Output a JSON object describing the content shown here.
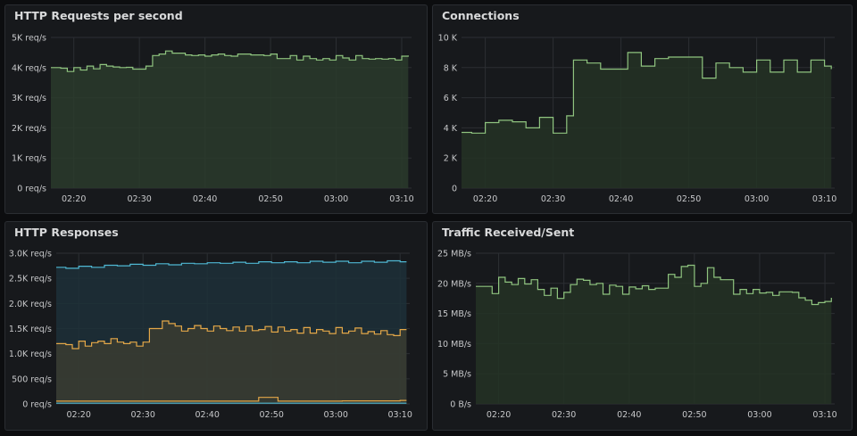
{
  "chart_data": [
    {
      "id": "rps",
      "type": "line",
      "title": "HTTP Requests per second",
      "ylim": [
        0,
        5000
      ],
      "yticks": [
        0,
        1000,
        2000,
        3000,
        4000,
        5000
      ],
      "ytick_labels": [
        "0 req/s",
        "1K req/s",
        "2K req/s",
        "3K req/s",
        "4K req/s",
        "5K req/s"
      ],
      "xlim": [
        16.5,
        71.5
      ],
      "xticks": [
        20,
        30,
        40,
        50,
        60,
        70
      ],
      "xtick_labels": [
        "02:20",
        "02:30",
        "02:40",
        "02:50",
        "03:00",
        "03:10"
      ],
      "series": [
        {
          "color": "#8fc47f",
          "fill": "#2a3b2b",
          "x": [
            16.5,
            18,
            19,
            20,
            21,
            22,
            23,
            24,
            25,
            26,
            27,
            28,
            29,
            30,
            31,
            32,
            33,
            34,
            35,
            36,
            37,
            38,
            39,
            40,
            41,
            42,
            43,
            44,
            45,
            46,
            47,
            48,
            49,
            50,
            51,
            52,
            53,
            54,
            55,
            56,
            57,
            58,
            59,
            60,
            61,
            62,
            63,
            64,
            65,
            66,
            67,
            68,
            69,
            70,
            71
          ],
          "y": [
            4000,
            3980,
            3870,
            4000,
            3920,
            4050,
            3960,
            4100,
            4050,
            4020,
            4000,
            4010,
            3950,
            3950,
            4050,
            4400,
            4450,
            4550,
            4480,
            4480,
            4420,
            4400,
            4420,
            4380,
            4420,
            4450,
            4400,
            4380,
            4450,
            4450,
            4420,
            4420,
            4400,
            4450,
            4300,
            4300,
            4400,
            4250,
            4380,
            4300,
            4250,
            4300,
            4250,
            4400,
            4320,
            4250,
            4400,
            4300,
            4280,
            4300,
            4280,
            4300,
            4250,
            4380,
            4400
          ]
        }
      ]
    },
    {
      "id": "conn",
      "type": "line",
      "title": "Connections",
      "ylim": [
        0,
        10000
      ],
      "yticks": [
        0,
        2000,
        4000,
        6000,
        8000,
        10000
      ],
      "ytick_labels": [
        "0",
        "2 K",
        "4 K",
        "6 K",
        "8 K",
        "10 K"
      ],
      "xlim": [
        16.5,
        71.5
      ],
      "xticks": [
        20,
        30,
        40,
        50,
        60,
        70
      ],
      "xtick_labels": [
        "02:20",
        "02:30",
        "02:40",
        "02:50",
        "03:00",
        "03:10"
      ],
      "series": [
        {
          "color": "#8fc47f",
          "fill": "#243325",
          "x": [
            16.5,
            18,
            20,
            22,
            24,
            26,
            28,
            30,
            32,
            33,
            35,
            37,
            39,
            41,
            43,
            45,
            47,
            50,
            52,
            54,
            56,
            58,
            60,
            62,
            64,
            66,
            68,
            70,
            71
          ],
          "y": [
            3700,
            3650,
            4350,
            4500,
            4400,
            4000,
            4700,
            3650,
            4800,
            8500,
            8300,
            7900,
            7900,
            9000,
            8100,
            8600,
            8700,
            8700,
            7300,
            8300,
            8000,
            7700,
            8500,
            7700,
            8500,
            7700,
            8500,
            8100,
            7900
          ]
        }
      ]
    },
    {
      "id": "resp",
      "type": "area",
      "title": "HTTP Responses",
      "ylim": [
        0,
        3000
      ],
      "yticks": [
        0,
        500,
        1000,
        1500,
        2000,
        2500,
        3000
      ],
      "ytick_labels": [
        "0 req/s",
        "500 req/s",
        "1.0K req/s",
        "1.5K req/s",
        "2.0K req/s",
        "2.5K req/s",
        "3.0K req/s"
      ],
      "xlim": [
        16.5,
        71.5
      ],
      "xticks": [
        20,
        30,
        40,
        50,
        60,
        70
      ],
      "xtick_labels": [
        "02:20",
        "02:30",
        "02:40",
        "02:50",
        "03:00",
        "03:10"
      ],
      "series": [
        {
          "color": "#4fb7d2",
          "fill": "#1d3038",
          "x": [
            16.5,
            18,
            20,
            22,
            24,
            26,
            28,
            30,
            32,
            34,
            36,
            38,
            40,
            42,
            44,
            46,
            48,
            50,
            52,
            54,
            56,
            58,
            60,
            62,
            64,
            66,
            68,
            70,
            71
          ],
          "y": [
            2720,
            2700,
            2740,
            2720,
            2760,
            2750,
            2780,
            2760,
            2790,
            2770,
            2800,
            2790,
            2810,
            2800,
            2820,
            2800,
            2830,
            2810,
            2830,
            2810,
            2840,
            2820,
            2840,
            2810,
            2840,
            2820,
            2850,
            2830,
            2830
          ]
        },
        {
          "color": "#e3a748",
          "fill": "#3a3c31",
          "x": [
            16.5,
            18,
            19,
            20,
            21,
            22,
            23,
            24,
            25,
            26,
            27,
            28,
            29,
            30,
            31,
            32,
            33,
            34,
            35,
            36,
            37,
            38,
            39,
            40,
            41,
            42,
            43,
            44,
            45,
            46,
            47,
            48,
            49,
            50,
            51,
            52,
            53,
            54,
            55,
            56,
            57,
            58,
            59,
            60,
            61,
            62,
            63,
            64,
            65,
            66,
            67,
            68,
            69,
            70,
            71
          ],
          "y": [
            1200,
            1180,
            1100,
            1250,
            1150,
            1220,
            1250,
            1200,
            1300,
            1230,
            1200,
            1230,
            1150,
            1230,
            1500,
            1500,
            1650,
            1600,
            1550,
            1450,
            1500,
            1560,
            1500,
            1450,
            1550,
            1500,
            1460,
            1530,
            1450,
            1550,
            1460,
            1480,
            1540,
            1430,
            1530,
            1450,
            1480,
            1410,
            1520,
            1410,
            1480,
            1450,
            1400,
            1520,
            1410,
            1450,
            1510,
            1400,
            1440,
            1390,
            1460,
            1380,
            1360,
            1480,
            1480
          ]
        },
        {
          "color": "#e3a748",
          "fill": "",
          "x": [
            16.5,
            25,
            26,
            47,
            48,
            50,
            51,
            60,
            61,
            70,
            71
          ],
          "y": [
            55,
            55,
            55,
            55,
            130,
            130,
            55,
            55,
            60,
            70,
            70
          ]
        },
        {
          "color": "#4fb7d2",
          "fill": "",
          "x": [
            16.5,
            71
          ],
          "y": [
            15,
            15
          ]
        }
      ]
    },
    {
      "id": "traffic",
      "type": "line",
      "title": "Traffic Received/Sent",
      "ylim": [
        0,
        25
      ],
      "yticks": [
        0,
        5,
        10,
        15,
        20,
        25
      ],
      "ytick_labels": [
        "0 B/s",
        "5 MB/s",
        "10 MB/s",
        "15 MB/s",
        "20 MB/s",
        "25 MB/s"
      ],
      "xlim": [
        16.5,
        71.5
      ],
      "xticks": [
        20,
        30,
        40,
        50,
        60,
        70
      ],
      "xtick_labels": [
        "02:20",
        "02:30",
        "02:40",
        "02:50",
        "03:00",
        "03:10"
      ],
      "series": [
        {
          "color": "#8fc47f",
          "fill": "#243325",
          "x": [
            16.5,
            18,
            19,
            20,
            21,
            22,
            23,
            24,
            25,
            26,
            27,
            28,
            29,
            30,
            31,
            32,
            33,
            34,
            35,
            36,
            37,
            38,
            39,
            40,
            41,
            42,
            43,
            44,
            45,
            46,
            47,
            48,
            49,
            50,
            51,
            52,
            53,
            54,
            55,
            56,
            57,
            58,
            59,
            60,
            61,
            62,
            63,
            64,
            65,
            66,
            67,
            68,
            69,
            70,
            71
          ],
          "y": [
            19.5,
            19.5,
            18.3,
            21.0,
            20.2,
            19.8,
            20.8,
            19.9,
            20.6,
            19.0,
            18.0,
            19.2,
            17.5,
            18.5,
            19.8,
            20.7,
            20.5,
            19.8,
            20.0,
            18.2,
            19.7,
            19.5,
            18.2,
            19.4,
            19.1,
            19.6,
            19.0,
            19.2,
            19.2,
            21.5,
            21.0,
            22.8,
            23.0,
            19.5,
            20.0,
            22.6,
            21.0,
            20.6,
            20.6,
            18.2,
            19.0,
            18.3,
            19.0,
            18.4,
            18.5,
            18.0,
            18.6,
            18.6,
            18.5,
            17.6,
            17.2,
            16.5,
            16.8,
            17.0,
            17.6
          ]
        }
      ]
    }
  ]
}
